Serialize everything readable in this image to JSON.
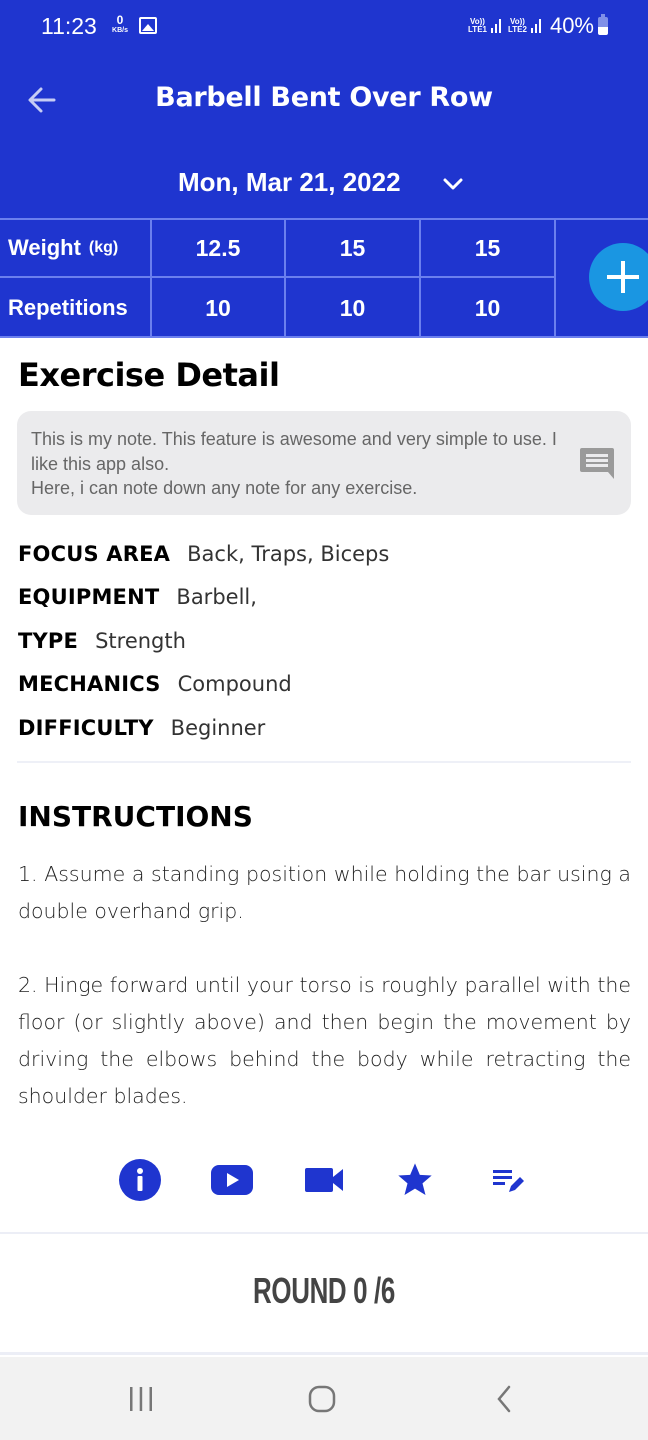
{
  "status_bar": {
    "time": "11:23",
    "net_speed_value": "0",
    "net_speed_unit": "KB/s",
    "sim1": "LTE1",
    "sim2": "LTE2",
    "volte": "Vo))",
    "battery": "40%"
  },
  "header": {
    "title": "Barbell Bent Over Row",
    "date": "Mon, Mar 21, 2022",
    "back_icon": "arrow-left-icon",
    "date_dropdown_icon": "chevron-down-icon"
  },
  "sets_table": {
    "weight_label": "Weight",
    "weight_unit": "(kg)",
    "reps_label": "Repetitions",
    "sets": [
      {
        "weight": "12.5",
        "reps": "10"
      },
      {
        "weight": "15",
        "reps": "10"
      },
      {
        "weight": "15",
        "reps": "10"
      }
    ],
    "add_icon": "plus-icon"
  },
  "detail": {
    "heading": "Exercise Detail",
    "note": "This is my note. This feature is awesome and very simple to use. I like this app also.\nHere, i can note down any note for any exercise.",
    "note_icon": "comment-icon",
    "properties": [
      {
        "key": "FOCUS AREA",
        "value": "Back, Traps, Biceps"
      },
      {
        "key": "EQUIPMENT",
        "value": "Barbell,"
      },
      {
        "key": "TYPE",
        "value": "Strength"
      },
      {
        "key": "MECHANICS",
        "value": "Compound"
      },
      {
        "key": "DIFFICULTY",
        "value": "Beginner"
      }
    ]
  },
  "instructions": {
    "heading": "INSTRUCTIONS",
    "steps": [
      "1. Assume a standing position while holding the bar using a double overhand grip.",
      "2. Hinge forward until your torso is roughly parallel with the floor (or slightly above) and then begin the movement by driving the elbows behind the body while retracting the shoulder blades."
    ]
  },
  "actions": [
    {
      "name": "info",
      "icon": "info-icon"
    },
    {
      "name": "youtube",
      "icon": "youtube-icon"
    },
    {
      "name": "video",
      "icon": "videocam-icon"
    },
    {
      "name": "favorite",
      "icon": "star-icon"
    },
    {
      "name": "edit-notes",
      "icon": "edit-note-icon"
    }
  ],
  "round": {
    "text": "ROUND 0 /6",
    "current": 0,
    "total": 6
  },
  "nav_bar": {
    "recents_icon": "recents-icon",
    "home_icon": "home-icon",
    "back_icon": "back-chevron-icon"
  },
  "colors": {
    "primary": "#1f35cf",
    "fab": "#1a96e2",
    "grid_line": "#6b7fee",
    "note_bg": "#ebebed"
  }
}
